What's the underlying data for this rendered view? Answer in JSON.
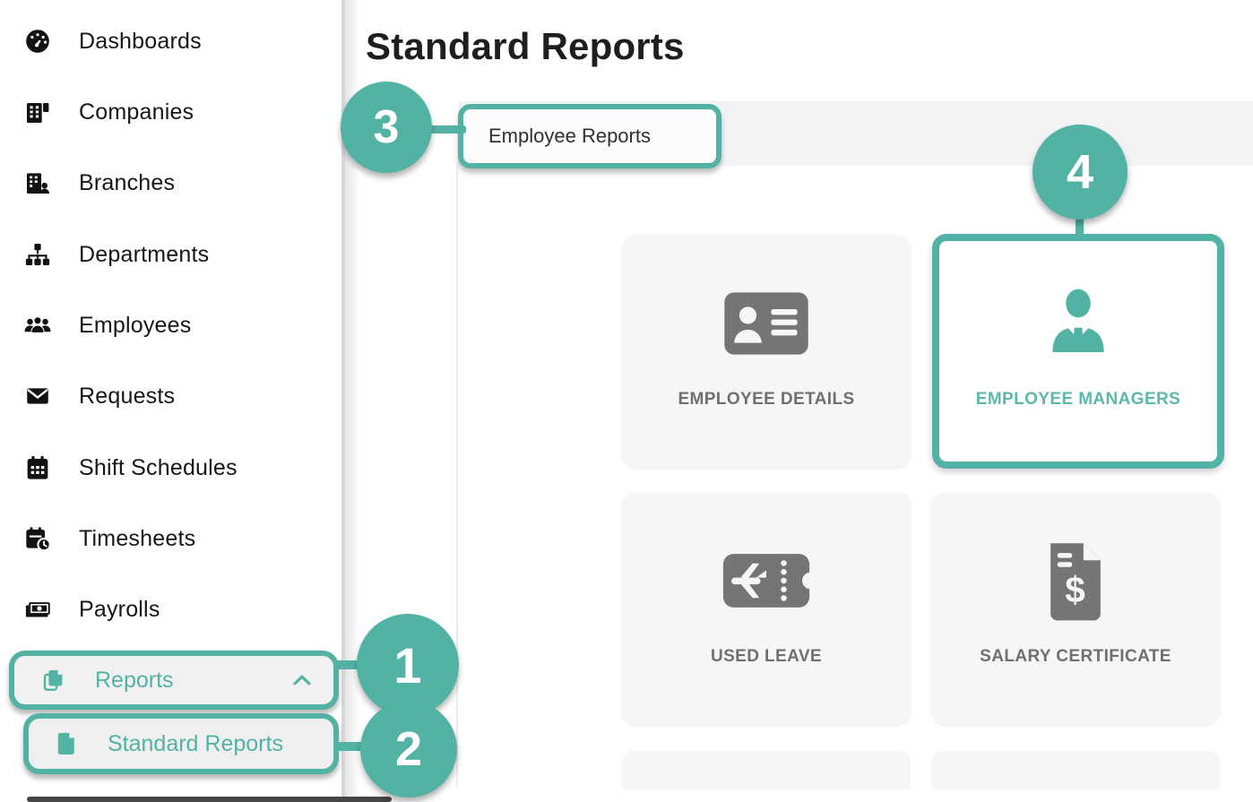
{
  "colors": {
    "accent_teal": "#52b3a4",
    "sidebar_text": "#161616",
    "card_bg": "#f6f6f6",
    "card_label_gray": "#6f6f6f",
    "icon_gray": "#757575",
    "tabbar_bg": "#f3f3f3"
  },
  "page": {
    "title": "Standard Reports"
  },
  "sidebar": {
    "items": [
      {
        "label": "Dashboards",
        "icon": "dashboard-gauge-icon"
      },
      {
        "label": "Companies",
        "icon": "company-building-icon"
      },
      {
        "label": "Branches",
        "icon": "branch-building-person-icon"
      },
      {
        "label": "Departments",
        "icon": "org-chart-icon"
      },
      {
        "label": "Employees",
        "icon": "users-icon"
      },
      {
        "label": "Requests",
        "icon": "envelope-icon"
      },
      {
        "label": "Shift Schedules",
        "icon": "calendar-icon"
      },
      {
        "label": "Timesheets",
        "icon": "calendar-clock-icon"
      },
      {
        "label": "Payrolls",
        "icon": "money-bill-icon"
      }
    ],
    "reports_item": {
      "label": "Reports",
      "icon": "copy-documents-icon",
      "state": "expanded"
    },
    "standard_reports_item": {
      "label": "Standard Reports",
      "icon": "file-icon",
      "state": "active"
    }
  },
  "tabs": {
    "employee_reports": "Employee Reports"
  },
  "cards": [
    {
      "label": "EMPLOYEE DETAILS",
      "icon": "id-card-icon",
      "active": false
    },
    {
      "label": "EMPLOYEE MANAGERS",
      "icon": "user-tie-icon",
      "active": true
    },
    {
      "label": "USED LEAVE",
      "icon": "plane-ticket-icon",
      "active": false
    },
    {
      "label": "SALARY CERTIFICATE",
      "icon": "salary-document-icon",
      "active": false
    }
  ],
  "annotations": {
    "badges": [
      "1",
      "2",
      "3",
      "4"
    ]
  }
}
